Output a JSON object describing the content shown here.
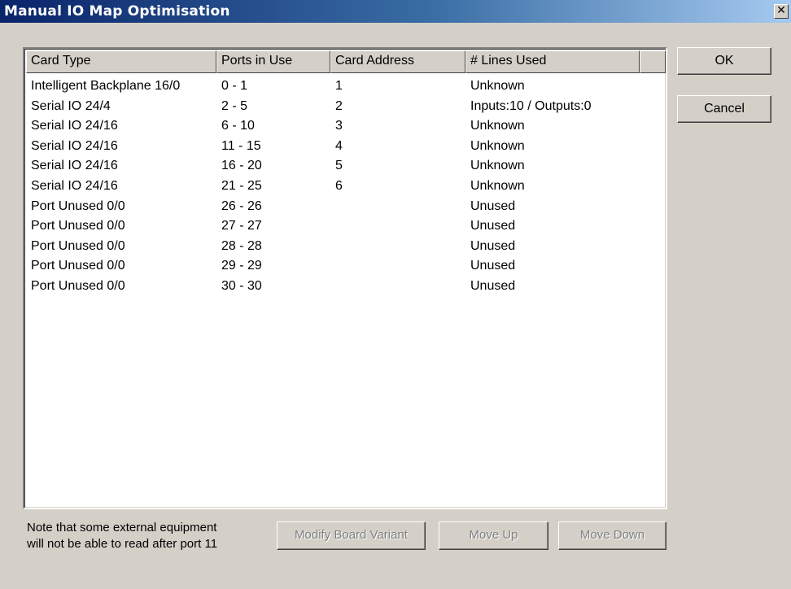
{
  "window": {
    "title": "Manual IO Map Optimisation",
    "close_glyph": "✕"
  },
  "list": {
    "columns": [
      "Card Type",
      "Ports in Use",
      "Card Address",
      "# Lines Used"
    ],
    "rows": [
      [
        "Intelligent Backplane 16/0",
        "0 - 1",
        "1",
        "Unknown"
      ],
      [
        "Serial IO 24/4",
        "2 - 5",
        "2",
        "Inputs:10 / Outputs:0"
      ],
      [
        "Serial IO 24/16",
        "6 - 10",
        "3",
        "Unknown"
      ],
      [
        "Serial IO 24/16",
        "11 - 15",
        "4",
        "Unknown"
      ],
      [
        "Serial IO 24/16",
        "16 - 20",
        "5",
        "Unknown"
      ],
      [
        "Serial IO 24/16",
        "21 - 25",
        "6",
        "Unknown"
      ],
      [
        "Port Unused 0/0",
        "26 - 26",
        "",
        "Unused"
      ],
      [
        "Port Unused 0/0",
        "27 - 27",
        "",
        "Unused"
      ],
      [
        "Port Unused 0/0",
        "28 - 28",
        "",
        "Unused"
      ],
      [
        "Port Unused 0/0",
        "29 - 29",
        "",
        "Unused"
      ],
      [
        "Port Unused 0/0",
        "30 - 30",
        "",
        "Unused"
      ]
    ]
  },
  "buttons": {
    "ok": "OK",
    "cancel": "Cancel",
    "modify": "Modify Board Variant",
    "move_up": "Move Up",
    "move_down": "Move Down"
  },
  "note": {
    "line1": "Note that some external equipment",
    "line2": "will not be able to read after port 11"
  }
}
